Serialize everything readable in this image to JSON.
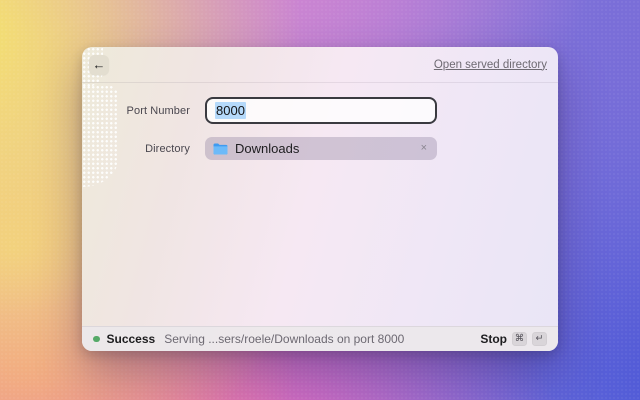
{
  "header": {
    "back_glyph": "←",
    "open_link": "Open served directory"
  },
  "form": {
    "port_label": "Port Number",
    "port_value": "8000",
    "directory_label": "Directory",
    "directory_value": "Downloads",
    "clear_glyph": "×"
  },
  "status": {
    "state": "Success",
    "message": "Serving ...sers/roele/Downloads on port 8000",
    "stop_label": "Stop",
    "key_command": "⌘",
    "key_return": "↵"
  },
  "colors": {
    "folder_blue": "#5bb0f8",
    "success_green": "#55a968",
    "selection_blue": "#b5d9fa",
    "link_gray": "#6e6a72",
    "input_border": "#3a3a40"
  }
}
